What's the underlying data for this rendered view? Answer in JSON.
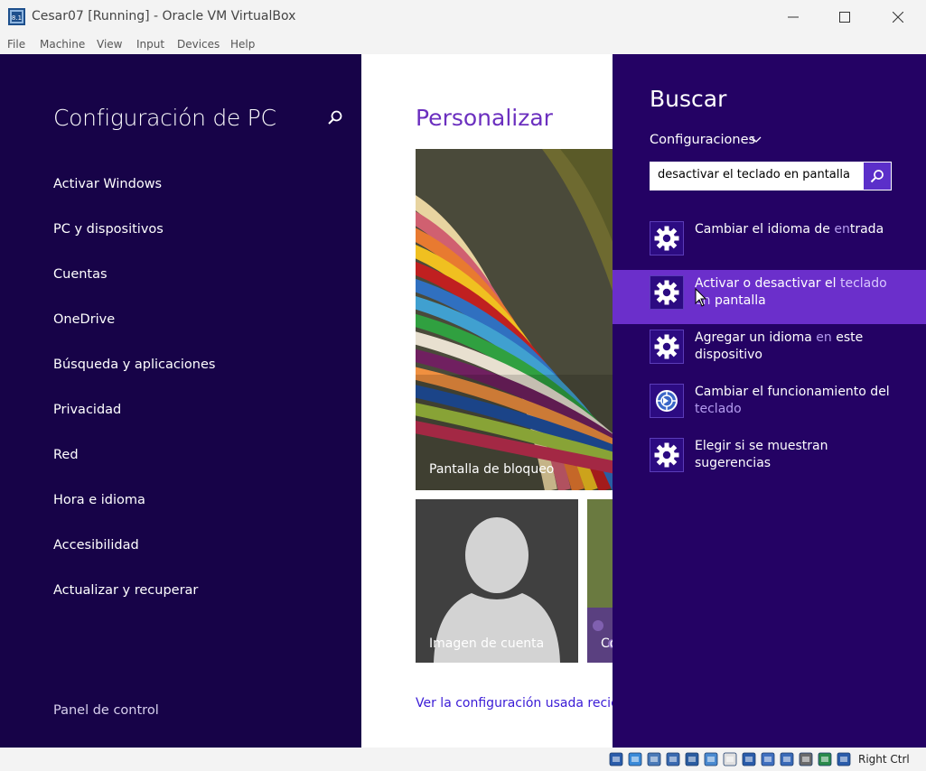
{
  "window": {
    "title": "Cesar07 [Running] - Oracle VM VirtualBox",
    "icon": "virtualbox-icon",
    "controls": [
      "minimize-icon",
      "maximize-icon",
      "close-icon"
    ]
  },
  "menubar": {
    "items": [
      "File",
      "Machine",
      "View",
      "Input",
      "Devices",
      "Help"
    ]
  },
  "settings": {
    "title": "Configuración de PC",
    "search_icon": "search-icon",
    "nav": [
      "Activar Windows",
      "PC y dispositivos",
      "Cuentas",
      "OneDrive",
      "Búsqueda y aplicaciones",
      "Privacidad",
      "Red",
      "Hora e idioma",
      "Accesibilidad",
      "Actualizar y recuperar"
    ],
    "footer": "Panel de control"
  },
  "personalize": {
    "title": "Personalizar",
    "lock_screen": "Pantalla de bloqueo",
    "account_picture": "Imagen de cuenta",
    "third_tile": "Co",
    "recent_link": "Ver la configuración usada recient"
  },
  "search": {
    "title": "Buscar",
    "scope": "Configuraciones",
    "query": "desactivar el teclado en pantalla",
    "results": [
      {
        "icon": "gear-icon",
        "parts": [
          {
            "t": "Cambiar el idioma de ",
            "h": false
          },
          {
            "t": "en",
            "h": true
          },
          {
            "t": "trada",
            "h": false
          }
        ]
      },
      {
        "icon": "gear-icon",
        "parts": [
          {
            "t": "Activar o desactivar el ",
            "h": false
          },
          {
            "t": "teclado en",
            "h": true
          },
          {
            "t": " pantalla",
            "h": false
          }
        ]
      },
      {
        "icon": "gear-icon",
        "parts": [
          {
            "t": "Agregar un idioma ",
            "h": false
          },
          {
            "t": "en",
            "h": true
          },
          {
            "t": " este dispositivo",
            "h": false
          }
        ]
      },
      {
        "icon": "ease-of-access-icon",
        "parts": [
          {
            "t": "Cambiar el funcionamiento del ",
            "h": false
          },
          {
            "t": "teclado",
            "h": true
          }
        ]
      },
      {
        "icon": "gear-icon",
        "parts": [
          {
            "t": "Elegir si se muestran sugerencias",
            "h": false
          }
        ]
      }
    ],
    "active_index": 1
  },
  "statusbar": {
    "host_key": "Right Ctrl",
    "icons": [
      "hard-disk-icon",
      "optical-drive-icon",
      "floppy-icon",
      "audio-icon",
      "network-icon",
      "usb-icon",
      "shared-folder-icon",
      "display-icon",
      "recording-icon",
      "mouse-integration-icon",
      "cpu-icon",
      "keyboard-capture-icon",
      "download-icon"
    ]
  },
  "colors": {
    "settings_bg": "#170348",
    "search_bg": "#240264",
    "active_result": "#6b2fcb",
    "accent": "#6b2fbf"
  }
}
